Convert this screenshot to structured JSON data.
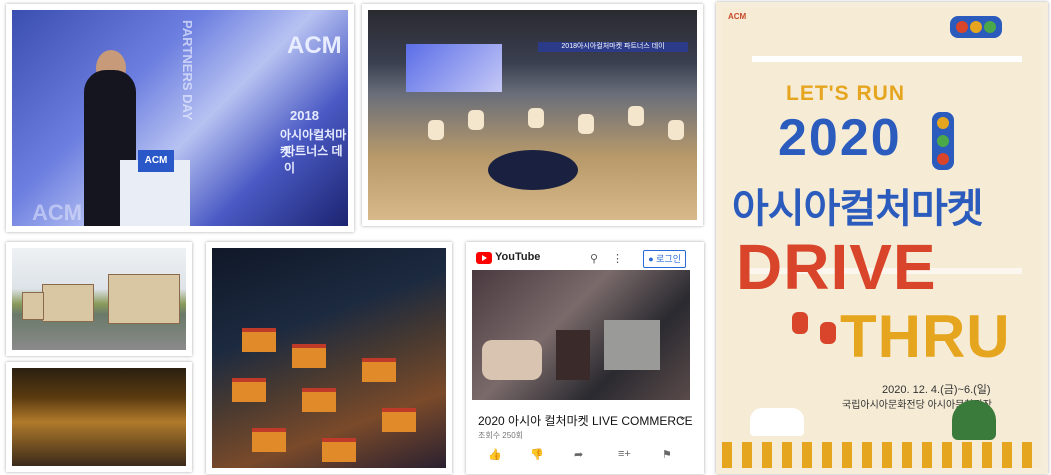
{
  "photos": {
    "stage": {
      "acm_logo": "ACM",
      "year": "2018",
      "kr_line1": "아시아컬처마켓",
      "kr_line2": "파트너스 데이",
      "partners_day": "PARTNERS DAY",
      "podium_sign": "ACM"
    },
    "ballroom": {
      "banner": "2018아시아컬처마켓 파트너스 데이"
    }
  },
  "youtube": {
    "brand": "YouTube",
    "login_label": "로그인",
    "video_title": "2020 아시아 컬처마켓 LIVE COMMERCE",
    "views": "조회수 250회",
    "action_icons": [
      "thumbs-up-icon",
      "thumbs-down-icon",
      "share-icon",
      "add-to-playlist-icon",
      "flag-icon"
    ]
  },
  "poster": {
    "small_logo": "ACM",
    "lets_run": "LET'S RUN",
    "year": "2020",
    "korean_title": "아시아컬처마켓",
    "drive": "DRIVE",
    "thru": "THRU",
    "date": "2020. 12. 4.(금)~6.(일)",
    "venue": "국립아시아문화전당 아시아문화광장",
    "colors": {
      "blue": "#2a5bbd",
      "red": "#d8452a",
      "yellow": "#e6a51f",
      "cream": "#f6ecd6"
    }
  }
}
